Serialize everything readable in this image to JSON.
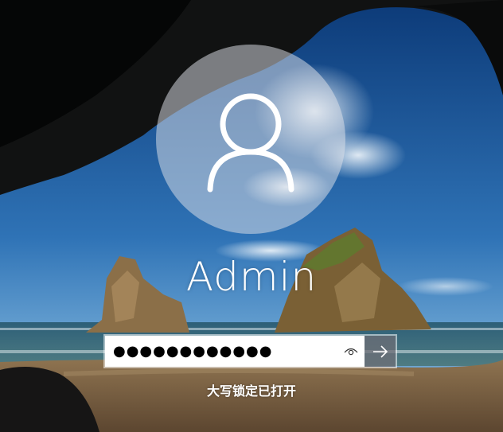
{
  "wallpaper": {
    "description_icon": "cave-beach-wallpaper"
  },
  "user": {
    "name": "Admin",
    "avatar_icon": "user-silhouette-icon"
  },
  "password": {
    "masked_value": "●●●●●●●●●●●●",
    "reveal_icon": "eye-icon",
    "submit_icon": "arrow-right-icon"
  },
  "status": {
    "caps_lock": "大写锁定已打开"
  },
  "colors": {
    "submit_bg": "#6e6e76",
    "input_bg": "#ffffff"
  }
}
